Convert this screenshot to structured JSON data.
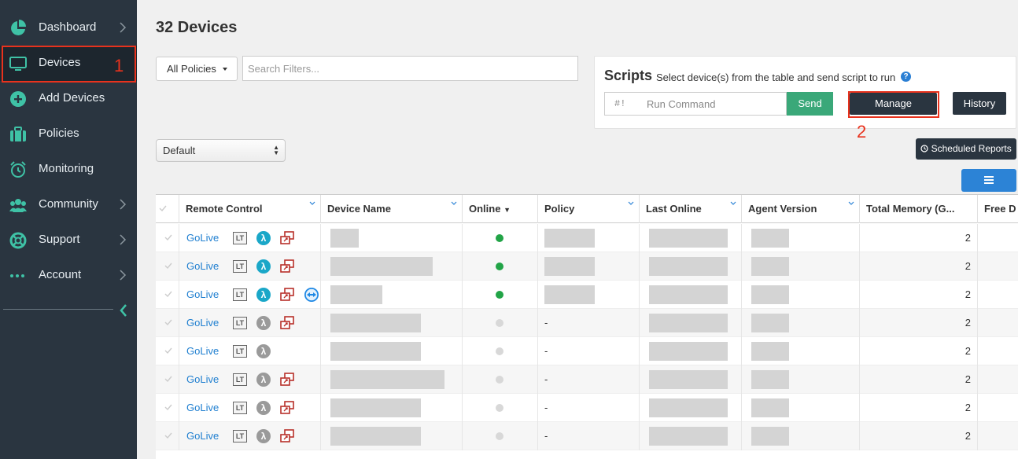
{
  "sidebar": {
    "items": [
      {
        "label": "Dashboard",
        "icon": "pie-chart-icon",
        "has_chevron": true
      },
      {
        "label": "Devices",
        "icon": "monitor-icon",
        "has_chevron": false,
        "active": true
      },
      {
        "label": "Add Devices",
        "icon": "plus-circle-icon",
        "has_chevron": false
      },
      {
        "label": "Policies",
        "icon": "briefcase-icon",
        "has_chevron": false
      },
      {
        "label": "Monitoring",
        "icon": "alarm-clock-icon",
        "has_chevron": false
      },
      {
        "label": "Community",
        "icon": "users-icon",
        "has_chevron": true
      },
      {
        "label": "Support",
        "icon": "lifebuoy-icon",
        "has_chevron": true
      },
      {
        "label": "Account",
        "icon": "dots-icon",
        "has_chevron": true
      }
    ],
    "accent_color": "#3fc2a6"
  },
  "annotations": {
    "devices_marker": "1",
    "manage_marker": "2",
    "color": "#e8321d"
  },
  "page": {
    "title": "32 Devices"
  },
  "filters": {
    "policy_dropdown": "All Policies",
    "search_placeholder": "Search Filters..."
  },
  "scripts": {
    "title": "Scripts",
    "description": "Select device(s) from the table and send script to run",
    "help_glyph": "?",
    "command_prefix": "#!",
    "command_placeholder": "Run Command",
    "send_label": "Send",
    "manage_label": "Manage",
    "history_label": "History"
  },
  "view_select": {
    "value": "Default"
  },
  "scheduled_reports_label": "Scheduled Reports",
  "table": {
    "columns": [
      "Remote Control",
      "Device Name",
      "Online",
      "Policy",
      "Last Online",
      "Agent Version",
      "Total Memory (G...",
      "Free D"
    ],
    "rows": [
      {
        "remote": "GoLive",
        "lambda_active": true,
        "remote_icon": true,
        "teamviewer": false,
        "online": true,
        "policy": "",
        "memory": "2"
      },
      {
        "remote": "GoLive",
        "lambda_active": true,
        "remote_icon": true,
        "teamviewer": false,
        "online": true,
        "policy": "",
        "memory": "2"
      },
      {
        "remote": "GoLive",
        "lambda_active": true,
        "remote_icon": true,
        "teamviewer": true,
        "online": true,
        "policy": "",
        "memory": "2"
      },
      {
        "remote": "GoLive",
        "lambda_active": false,
        "remote_icon": true,
        "teamviewer": false,
        "online": false,
        "policy": "-",
        "memory": "2"
      },
      {
        "remote": "GoLive",
        "lambda_active": false,
        "remote_icon": false,
        "teamviewer": false,
        "online": false,
        "policy": "-",
        "memory": "2"
      },
      {
        "remote": "GoLive",
        "lambda_active": false,
        "remote_icon": true,
        "teamviewer": false,
        "online": false,
        "policy": "-",
        "memory": "2"
      },
      {
        "remote": "GoLive",
        "lambda_active": false,
        "remote_icon": true,
        "teamviewer": false,
        "online": false,
        "policy": "-",
        "memory": "2"
      },
      {
        "remote": "GoLive",
        "lambda_active": false,
        "remote_icon": true,
        "teamviewer": false,
        "online": false,
        "policy": "-",
        "memory": "2"
      }
    ],
    "lt_label": "LT",
    "lambda_glyph": "λ",
    "online_color": "#22a447",
    "offline_color": "#d8d8d8"
  }
}
